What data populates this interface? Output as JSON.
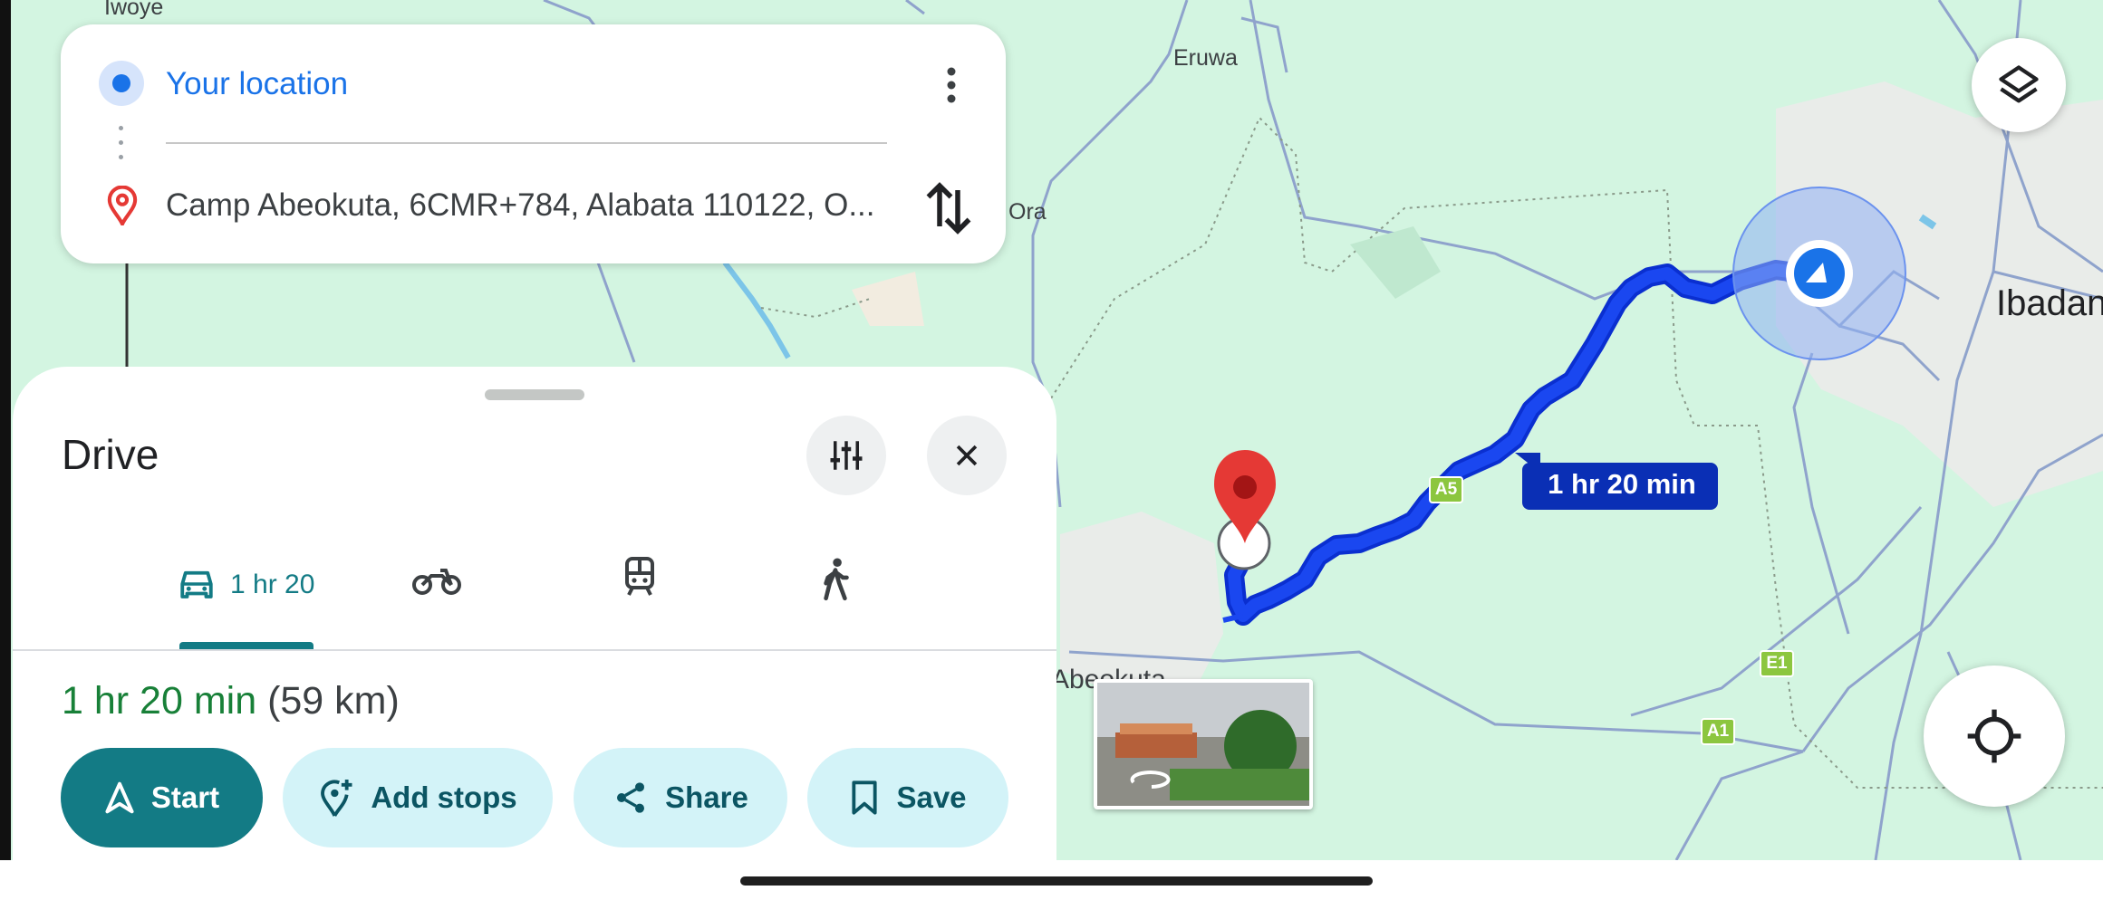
{
  "origin": {
    "label": "Your location"
  },
  "destination": {
    "label": "Camp Abeokuta, 6CMR+784, Alabata 110122, O..."
  },
  "sheet": {
    "title": "Drive",
    "modes": [
      {
        "icon": "car-icon",
        "label": "1 hr 20",
        "selected": true
      },
      {
        "icon": "motorcycle-icon",
        "label": ""
      },
      {
        "icon": "train-icon",
        "label": ""
      },
      {
        "icon": "walking-icon",
        "label": ""
      }
    ],
    "duration": "1 hr 20 min",
    "distance": "(59 km)",
    "actions": {
      "start": "Start",
      "add_stops": "Add stops",
      "share": "Share",
      "save": "Save"
    }
  },
  "map": {
    "route_label": "1 hr 20 min",
    "places": {
      "iwoye": "Iwoye",
      "eruwa": "Eruwa",
      "ora": "Ora",
      "ibadan": "Ibadan",
      "abeokuta": "Abeokuta"
    },
    "road_shields": {
      "a5": "A5",
      "e1": "E1",
      "a1": "A1"
    }
  },
  "colors": {
    "route": "#1a47f0",
    "accent_green": "#137b85",
    "map_bg": "#d3f5e1",
    "origin_blue": "#1a73e8",
    "pin_red": "#e53935"
  }
}
